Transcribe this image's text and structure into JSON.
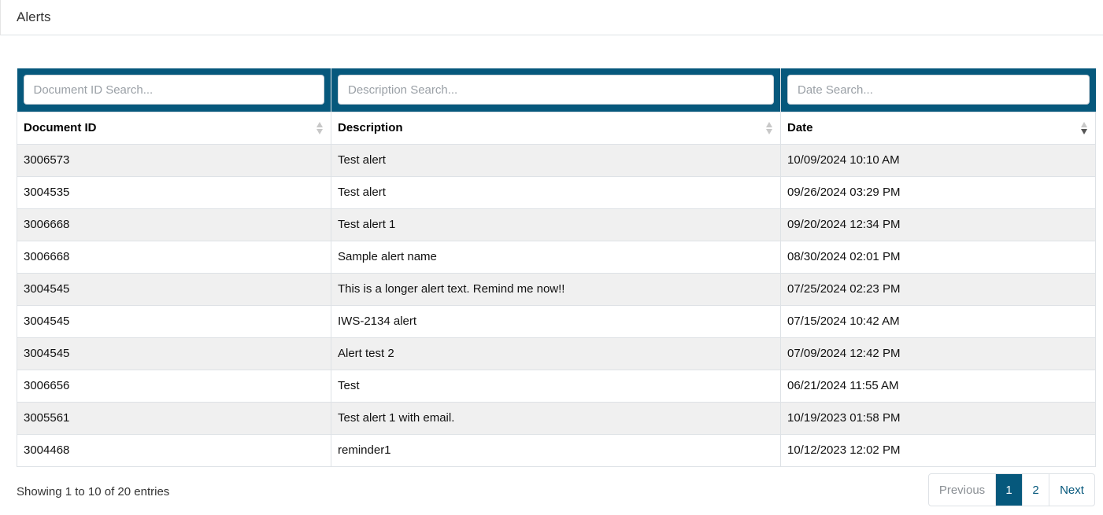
{
  "header": {
    "title": "Alerts"
  },
  "search": {
    "document_id_placeholder": "Document ID Search...",
    "description_placeholder": "Description Search...",
    "date_placeholder": "Date Search..."
  },
  "columns": [
    {
      "label": "Document ID",
      "sort": "none"
    },
    {
      "label": "Description",
      "sort": "none"
    },
    {
      "label": "Date",
      "sort": "desc"
    }
  ],
  "rows": [
    {
      "doc_id": "3006573",
      "description": "Test alert",
      "date": "10/09/2024 10:10 AM"
    },
    {
      "doc_id": "3004535",
      "description": "Test alert",
      "date": "09/26/2024 03:29 PM"
    },
    {
      "doc_id": "3006668",
      "description": "Test alert 1",
      "date": "09/20/2024 12:34 PM"
    },
    {
      "doc_id": "3006668",
      "description": "Sample alert name",
      "date": "08/30/2024 02:01 PM"
    },
    {
      "doc_id": "3004545",
      "description": "This is a longer alert text. Remind me now!!",
      "date": "07/25/2024 02:23 PM"
    },
    {
      "doc_id": "3004545",
      "description": "IWS-2134 alert",
      "date": "07/15/2024 10:42 AM"
    },
    {
      "doc_id": "3004545",
      "description": "Alert test 2",
      "date": "07/09/2024 12:42 PM"
    },
    {
      "doc_id": "3006656",
      "description": "Test",
      "date": "06/21/2024 11:55 AM"
    },
    {
      "doc_id": "3005561",
      "description": "Test alert 1 with email.",
      "date": "10/19/2023 01:58 PM"
    },
    {
      "doc_id": "3004468",
      "description": "reminder1",
      "date": "10/12/2023 12:02 PM"
    }
  ],
  "footer": {
    "info": "Showing 1 to 10 of 20 entries",
    "previous": "Previous",
    "pages": [
      "1",
      "2"
    ],
    "current_page": "1",
    "next": "Next"
  },
  "colors": {
    "header_bar": "#06587c",
    "active_page": "#06587c",
    "stripe": "#f0f0f0"
  }
}
